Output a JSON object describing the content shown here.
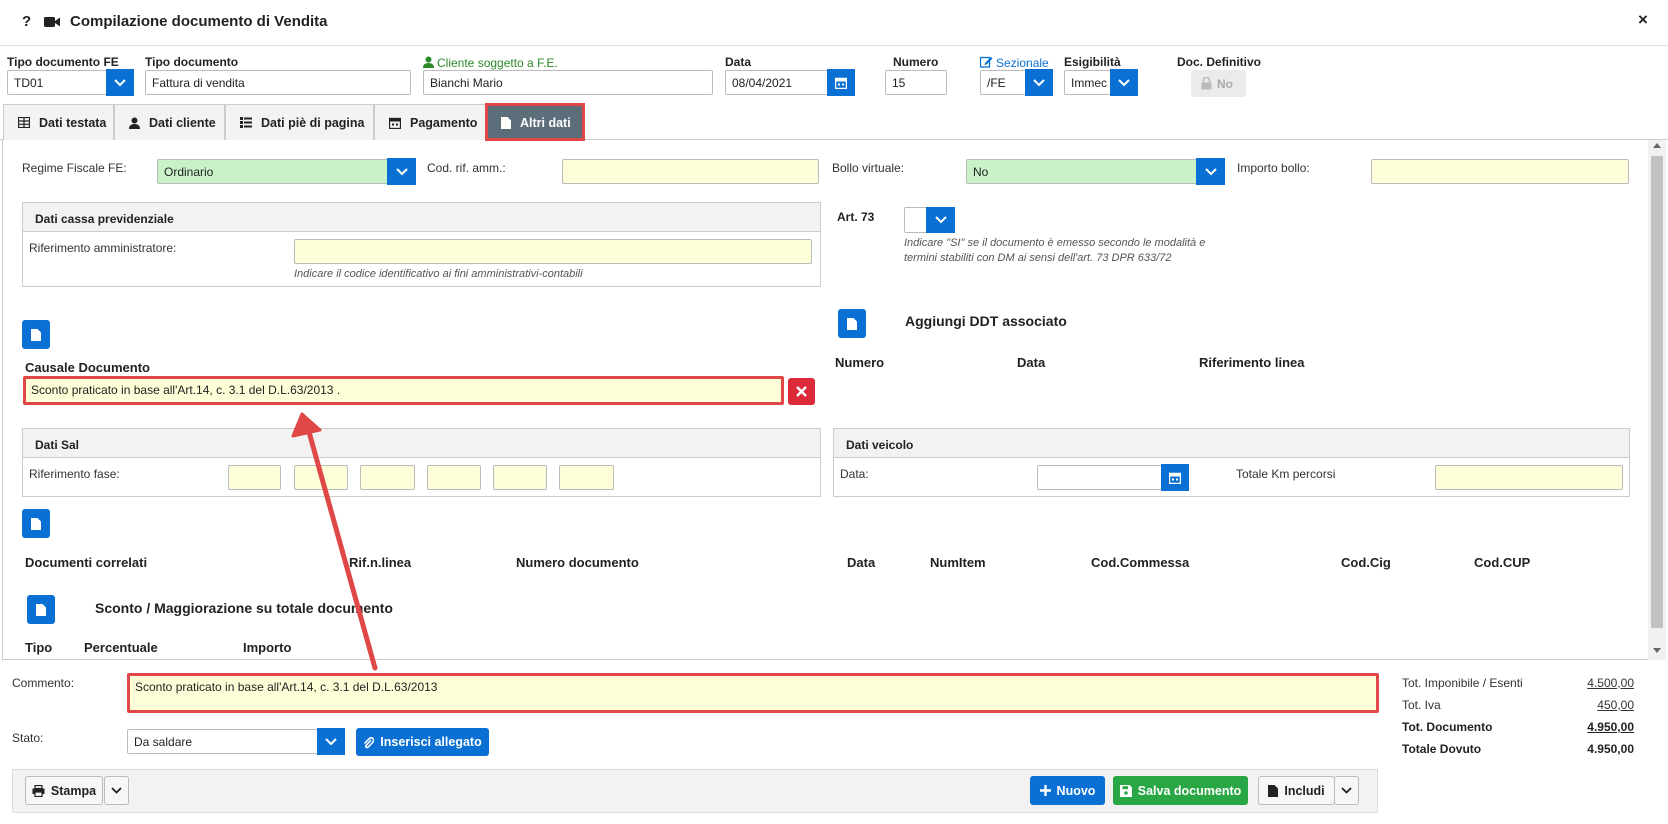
{
  "window": {
    "title": "Compilazione documento di Vendita",
    "help_glyph": "?",
    "close_glyph": "×"
  },
  "header": {
    "tipo_fe": {
      "label": "Tipo documento FE",
      "value": "TD01"
    },
    "tipo_doc": {
      "label": "Tipo documento",
      "value": "Fattura di vendita"
    },
    "cliente": {
      "label": "Cliente soggetto a F.E.",
      "value": "Bianchi Mario"
    },
    "data": {
      "label": "Data",
      "value": "08/04/2021"
    },
    "numero": {
      "label": "Numero",
      "value": "15"
    },
    "sezionale": {
      "label": "Sezionale",
      "value": "/FE"
    },
    "esigibilita": {
      "label": "Esigibilità",
      "value": "Immec"
    },
    "definitivo": {
      "label": "Doc. Definitivo",
      "value": "No"
    }
  },
  "tabs": [
    {
      "label": "Dati testata",
      "icon": "table-icon"
    },
    {
      "label": "Dati cliente",
      "icon": "user-icon"
    },
    {
      "label": "Dati piè di pagina",
      "icon": "list-icon"
    },
    {
      "label": "Pagamento",
      "icon": "calendar-icon"
    },
    {
      "label": "Altri dati",
      "icon": "file-icon",
      "active": true
    }
  ],
  "panel": {
    "regime": {
      "label": "Regime Fiscale FE:",
      "value": "Ordinario"
    },
    "codrif": {
      "label": "Cod. rif. amm.:",
      "value": ""
    },
    "bollo": {
      "label": "Bollo virtuale:",
      "value": "No"
    },
    "importo_bollo": {
      "label": "Importo bollo:",
      "value": ""
    },
    "cassa": {
      "title": "Dati cassa previdenziale",
      "rif_label": "Riferimento amministratore:",
      "rif_value": "",
      "hint": "Indicare il codice identificativo ai fini amministrativi-contabili"
    },
    "art73": {
      "label": "Art. 73",
      "hint": "Indicare \"SI\" se il documento è emesso secondo le modalità e termini stabiliti con DM ai sensi dell'art. 73 DPR 633/72"
    },
    "ddt": {
      "title": "Aggiungi DDT associato",
      "cols": [
        "Numero",
        "Data",
        "Riferimento linea"
      ]
    },
    "causale": {
      "label": "Causale Documento",
      "value": "Sconto praticato in base all'Art.14, c. 3.1 del D.L.63/2013 ."
    },
    "sal": {
      "title": "Dati Sal",
      "rif_label": "Riferimento fase:"
    },
    "veicolo": {
      "title": "Dati veicolo",
      "data_label": "Data:",
      "km_label": "Totale Km percorsi"
    },
    "correlati": {
      "cols": [
        "Documenti correlati",
        "Rif.n.linea",
        "Numero documento",
        "Data",
        "NumItem",
        "Cod.Commessa",
        "Cod.Cig",
        "Cod.CUP"
      ]
    },
    "sconto": {
      "title": "Sconto / Maggiorazione su totale documento",
      "cols": [
        "Tipo",
        "Percentuale",
        "Importo"
      ]
    }
  },
  "footer": {
    "commento": {
      "label": "Commento:",
      "value": "Sconto praticato in base all'Art.14, c. 3.1 del D.L.63/2013"
    },
    "stato": {
      "label": "Stato:",
      "value": "Da saldare"
    },
    "allegato_label": "Inserisci allegato",
    "totals": [
      {
        "label": "Tot. Imponibile / Esenti",
        "value": "4.500,00"
      },
      {
        "label": "Tot. Iva",
        "value": "450,00"
      },
      {
        "label": "Tot. Documento",
        "value": "4.950,00"
      },
      {
        "label": "Totale Dovuto",
        "value": "4.950,00"
      }
    ],
    "buttons": {
      "stampa": "Stampa",
      "nuovo": "Nuovo",
      "salva": "Salva documento",
      "includi": "Includi"
    }
  },
  "colors": {
    "accent": "#0a70d3",
    "highlight": "#e04848",
    "success": "#2aa745",
    "input_yellow": "#fefed8",
    "input_green": "#c9f2c9"
  }
}
